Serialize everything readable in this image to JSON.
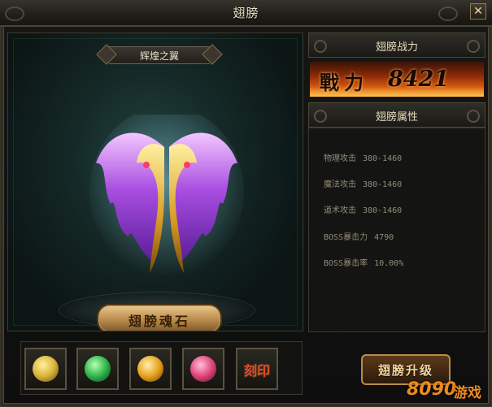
{
  "window": {
    "title": "翅膀",
    "close_glyph": "✕"
  },
  "preview": {
    "wing_name": "辉煌之翼",
    "soulstone_button": "翅膀魂石"
  },
  "power": {
    "header": "翅膀战力",
    "label": "戰力",
    "value": "8421"
  },
  "attributes": {
    "header": "翅膀属性",
    "rows": [
      {
        "name": "物理攻击",
        "value": "380-1460"
      },
      {
        "name": "魔法攻击",
        "value": "380-1460"
      },
      {
        "name": "道术攻击",
        "value": "380-1460"
      },
      {
        "name": "BOSS暴击力",
        "value": "4790"
      },
      {
        "name": "BOSS暴击率",
        "value": "10.00%"
      }
    ]
  },
  "skills": [
    {
      "icon": "tiger-mask-icon",
      "color": "#d9b43a"
    },
    {
      "icon": "green-dragon-icon",
      "color": "#2fb54a"
    },
    {
      "icon": "flame-orb-icon",
      "color": "#e8a21c"
    },
    {
      "icon": "pink-orb-icon",
      "color": "#e0457a"
    },
    {
      "icon": "engrave-icon",
      "label": "刻印"
    }
  ],
  "upgrade_button": "翅膀升级",
  "watermark": {
    "num": "8090",
    "text": "游戏"
  }
}
